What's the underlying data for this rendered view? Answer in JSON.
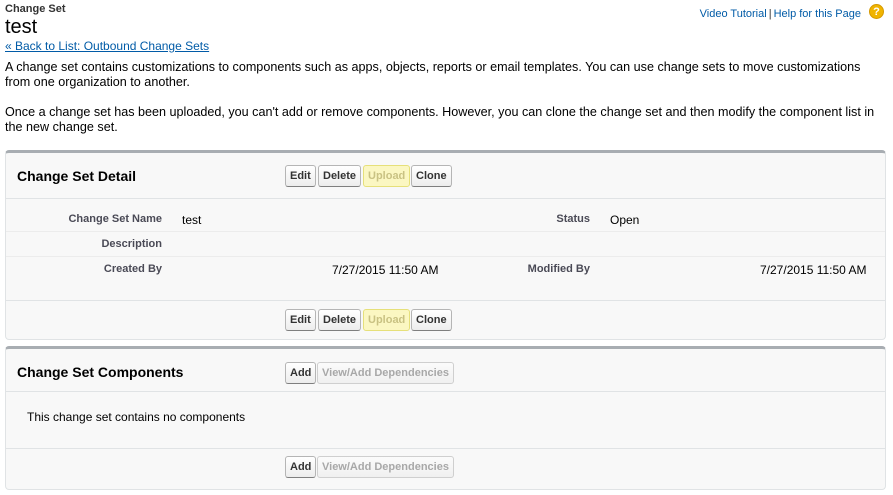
{
  "header": {
    "page_type": "Change Set",
    "title": "test"
  },
  "help": {
    "video_tutorial": "Video Tutorial",
    "separator": "|",
    "help_for_page": "Help for this Page",
    "help_icon": "?"
  },
  "back_link": "« Back to List: Outbound Change Sets",
  "intro": {
    "p1": "A change set contains customizations to components such as apps, objects, reports or email templates. You can use change sets to move customizations from one organization to another.",
    "p2": "Once a change set has been uploaded, you can't add or remove components. However, you can clone the change set and then modify the component list in the new change set."
  },
  "detail": {
    "title": "Change Set Detail",
    "buttons": {
      "edit": "Edit",
      "delete": "Delete",
      "upload": "Upload",
      "clone": "Clone"
    },
    "fields": {
      "name_label": "Change Set Name",
      "name_value": "test",
      "status_label": "Status",
      "status_value": "Open",
      "description_label": "Description",
      "description_value": "",
      "created_by_label": "Created By",
      "created_by_date": "7/27/2015 11:50 AM",
      "modified_by_label": "Modified By",
      "modified_by_date": "7/27/2015 11:50 AM"
    }
  },
  "components": {
    "title": "Change Set Components",
    "buttons": {
      "add": "Add",
      "view_dependencies": "View/Add Dependencies"
    },
    "empty_message": "This change set contains no components"
  },
  "colors": {
    "link": "#015ba7",
    "block_border": "#a8adb2",
    "block_bg": "#f8f8f8",
    "upload_disabled_bg": "#fbf7c2",
    "help_icon_bg": "#f0b400"
  }
}
